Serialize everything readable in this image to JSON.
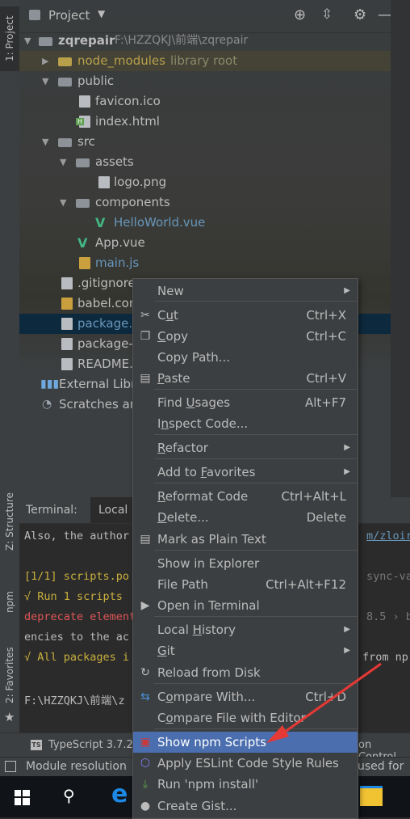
{
  "left_strip": {
    "project_tab": "1: Project",
    "structure_tab": "Z: Structure",
    "npm_tab": "npm",
    "favorites_tab": "2: Favorites"
  },
  "project": {
    "title": "Project",
    "tree": [
      {
        "name": "zqrepair",
        "path": "F:\\HZZQKJ\\前端\\zqrepair"
      },
      {
        "name": "node_modules",
        "extra": "library root"
      },
      {
        "name": "public"
      },
      {
        "name": "favicon.ico"
      },
      {
        "name": "index.html"
      },
      {
        "name": "src"
      },
      {
        "name": "assets"
      },
      {
        "name": "logo.png"
      },
      {
        "name": "components"
      },
      {
        "name": "HelloWorld.vue"
      },
      {
        "name": "App.vue"
      },
      {
        "name": "main.js"
      },
      {
        "name": ".gitignore"
      },
      {
        "name": "babel.con"
      },
      {
        "name": "package.js"
      },
      {
        "name": "package-"
      },
      {
        "name": "README."
      },
      {
        "name": "External Libr"
      },
      {
        "name": "Scratches an"
      }
    ]
  },
  "terminal": {
    "label": "Terminal:",
    "tab": "Local",
    "lines": [
      {
        "text": "Also, the author",
        "right": "m/zloirc"
      },
      {
        "text": ""
      },
      {
        "text": "[1/1] scripts.po",
        "right": "sync-val"
      },
      {
        "text": "√ Run 1 scripts"
      },
      {
        "text": "deprecate element",
        "right": "8.5 › b"
      },
      {
        "text": "encies to the ac"
      },
      {
        "text": "√ All packages i",
        "right": "from np"
      },
      {
        "text": ""
      },
      {
        "text": "F:\\HZZQKJ\\前端\\z"
      }
    ]
  },
  "toolbar": {
    "typescript": "TypeScript 3.7.2",
    "version_control": "on Control"
  },
  "status": {
    "text": "Module resolution",
    "right": "used for"
  },
  "menu": {
    "items": [
      {
        "label": "New",
        "shortcut": "",
        "submenu": true,
        "icon": ""
      },
      {
        "label": "Cut",
        "shortcut": "Ctrl+X",
        "icon": "scissors-icon"
      },
      {
        "label": "Copy",
        "shortcut": "Ctrl+C",
        "icon": "copy-icon"
      },
      {
        "label": "Copy Path...",
        "shortcut": "",
        "icon": ""
      },
      {
        "label": "Paste",
        "shortcut": "Ctrl+V",
        "icon": "clipboard-icon"
      },
      {
        "label": "Find Usages",
        "shortcut": "Alt+F7",
        "icon": ""
      },
      {
        "label": "Inspect Code...",
        "shortcut": "",
        "icon": ""
      },
      {
        "label": "Refactor",
        "shortcut": "",
        "submenu": true,
        "icon": ""
      },
      {
        "label": "Add to Favorites",
        "shortcut": "",
        "submenu": true,
        "icon": ""
      },
      {
        "label": "Reformat Code",
        "shortcut": "Ctrl+Alt+L",
        "icon": ""
      },
      {
        "label": "Delete...",
        "shortcut": "Delete",
        "icon": ""
      },
      {
        "label": "Mark as Plain Text",
        "shortcut": "",
        "icon": "text-file-icon"
      },
      {
        "label": "Show in Explorer",
        "shortcut": "",
        "icon": ""
      },
      {
        "label": "File Path",
        "shortcut": "Ctrl+Alt+F12",
        "icon": ""
      },
      {
        "label": "Open in Terminal",
        "shortcut": "",
        "icon": "terminal-icon"
      },
      {
        "label": "Local History",
        "shortcut": "",
        "submenu": true,
        "icon": ""
      },
      {
        "label": "Git",
        "shortcut": "",
        "submenu": true,
        "icon": ""
      },
      {
        "label": "Reload from Disk",
        "shortcut": "",
        "icon": "reload-icon"
      },
      {
        "label": "Compare With...",
        "shortcut": "Ctrl+D",
        "icon": "compare-icon"
      },
      {
        "label": "Compare File with Editor",
        "shortcut": "",
        "icon": ""
      },
      {
        "label": "Show npm Scripts",
        "shortcut": "",
        "icon": "npm-icon",
        "selected": true
      },
      {
        "label": "Apply ESLint Code Style Rules",
        "shortcut": "",
        "icon": "eslint-icon"
      },
      {
        "label": "Run 'npm install'",
        "shortcut": "",
        "icon": "download-icon"
      },
      {
        "label": "Create Gist...",
        "shortcut": "",
        "icon": "github-icon"
      }
    ]
  },
  "colors": {
    "accent": "#4b6eaf",
    "annotation_arrow": "#e53935",
    "node_modules": "#b8a04b",
    "link_blue": "#6897bb"
  }
}
